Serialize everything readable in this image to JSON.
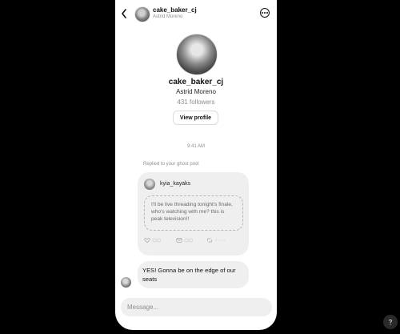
{
  "header": {
    "username": "cake_baker_cj",
    "name": "Astrid Moreno",
    "back_icon": "chevron-left-icon",
    "more_icon": "more-options-icon"
  },
  "profile": {
    "username": "cake_baker_cj",
    "name": "Astrid Moreno",
    "followers": "431 followers",
    "view_profile_label": "View profile"
  },
  "thread": {
    "timestamp": "9:41 AM",
    "replied_label": "Replied to your ghost post",
    "shared_post": {
      "author": "kyia_kayaks",
      "text": "I'll be live threading tonight's finale, who's watching with me? this is peak television!!",
      "actions": {
        "like": "like-icon",
        "comment": "comment-icon",
        "share": "share-icon"
      }
    },
    "reply": {
      "text": "YES! Gonna be on the edge of our seats"
    }
  },
  "composer": {
    "placeholder": "Message..."
  },
  "colors": {
    "background": "#000000",
    "surface": "#ffffff",
    "bubble": "#efefef",
    "muted_text": "#8e8e8e"
  }
}
